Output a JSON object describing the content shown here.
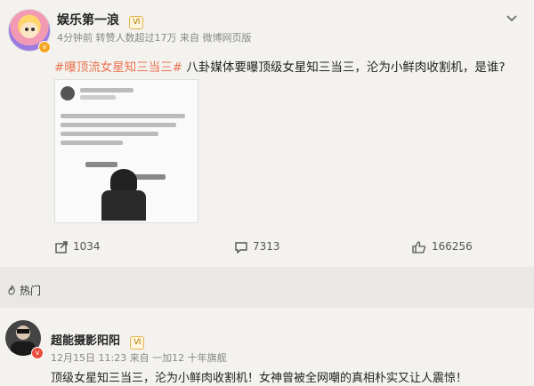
{
  "post": {
    "author": "娱乐第一浪",
    "badge": "Ⅵ",
    "meta": "4分钟前 转赞人数超过17万 来自 微博网页版",
    "topic": "#曝顶流女星知三当三#",
    "text": "八卦媒体要曝顶级女星知三当三，沦为小鲜肉收割机，是谁?",
    "share_count": "1034",
    "comment_count": "7313",
    "like_count": "166256"
  },
  "hot": {
    "label": "热门"
  },
  "comment": {
    "author": "超能摄影阳阳",
    "meta": "12月15日 11:23 来自 一加12 十年旗舰",
    "text": "顶级女星知三当三，沦为小鲜肉收割机！女神曾被全网嘲的真相朴实又让人震惊！"
  },
  "colors": {
    "topic": "#eb7350",
    "verified": "#f5a623"
  }
}
